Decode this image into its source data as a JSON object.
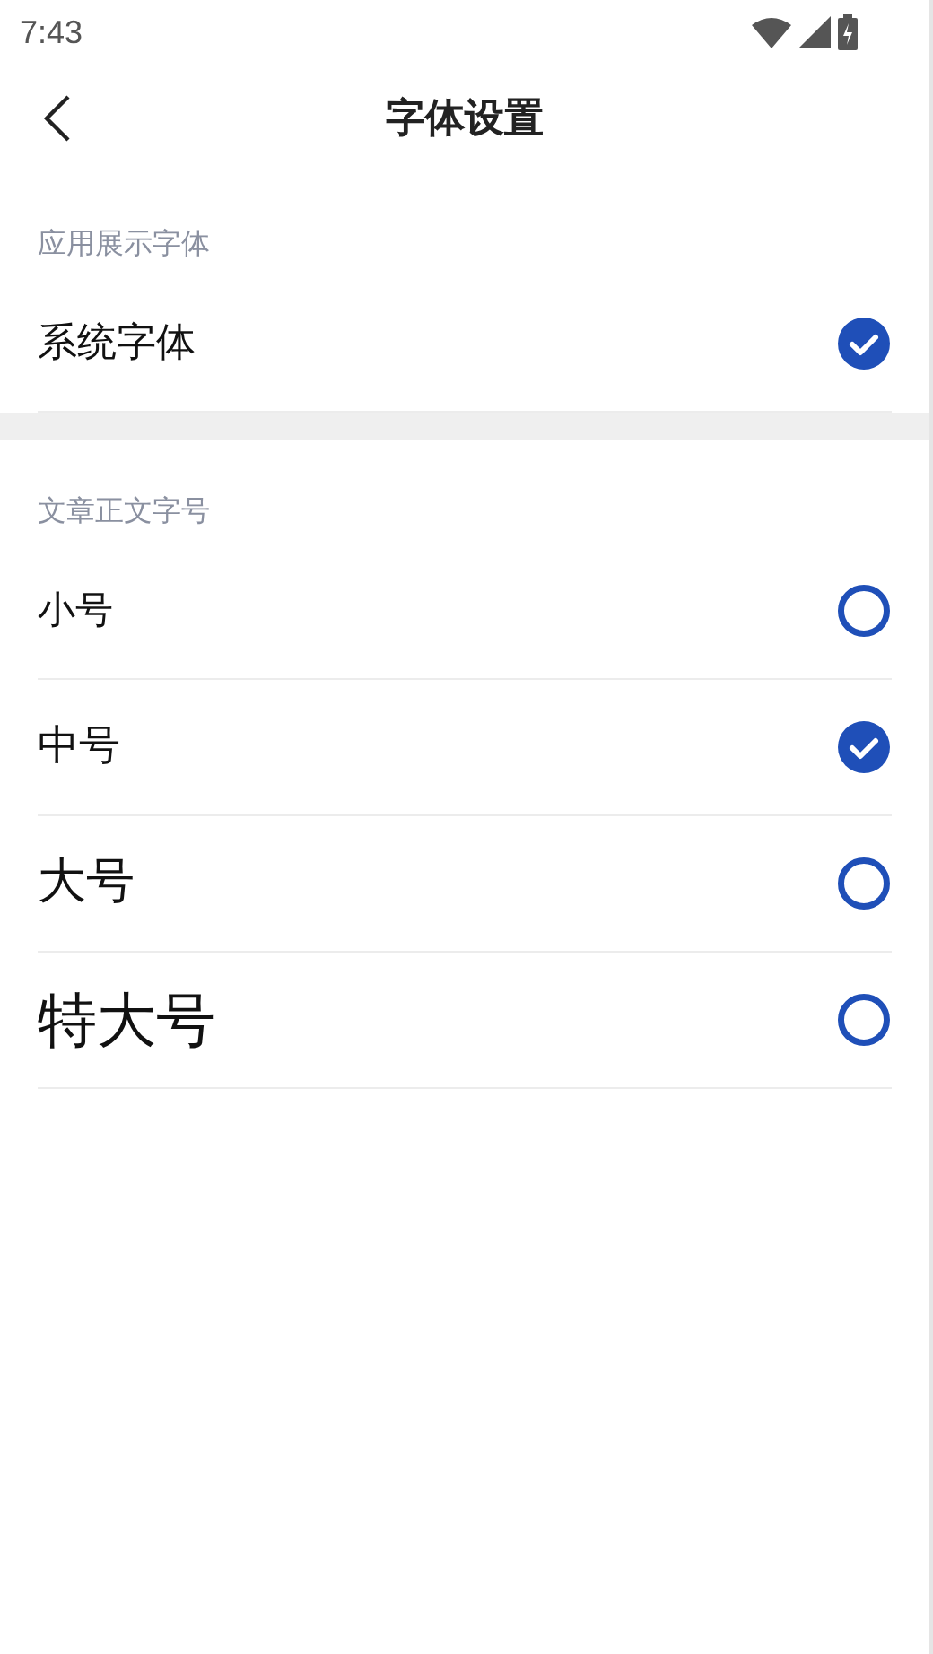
{
  "status_bar": {
    "time": "7:43"
  },
  "header": {
    "title": "字体设置"
  },
  "sections": [
    {
      "label": "应用展示字体",
      "options": [
        {
          "label": "系统字体",
          "selected": true
        }
      ]
    },
    {
      "label": "文章正文字号",
      "options": [
        {
          "label": "小号",
          "selected": false
        },
        {
          "label": "中号",
          "selected": true
        },
        {
          "label": "大号",
          "selected": false
        },
        {
          "label": "特大号",
          "selected": false
        }
      ]
    }
  ]
}
